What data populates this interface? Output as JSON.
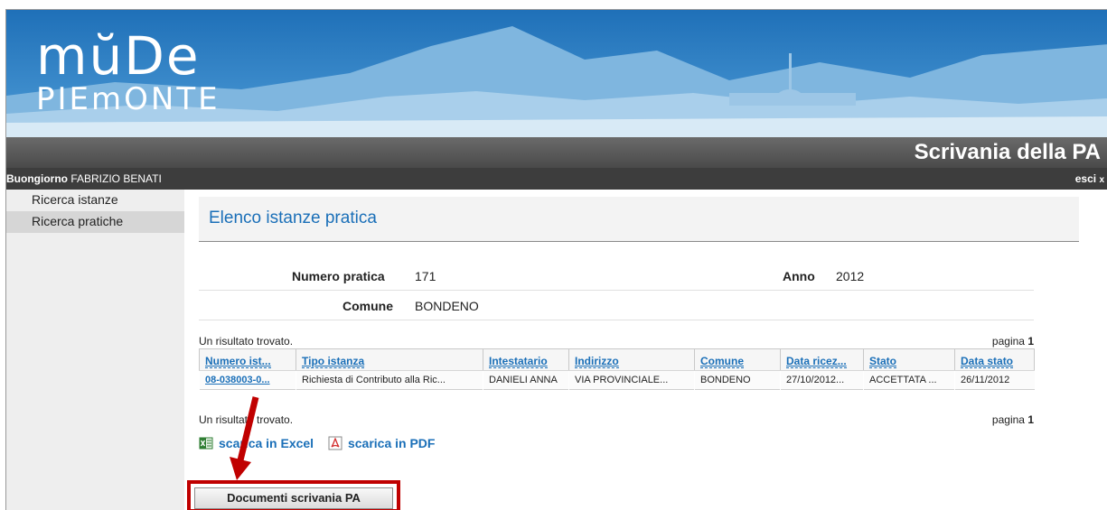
{
  "logo": {
    "line1": "mŭDe",
    "line2": "PIEmONTE"
  },
  "app_title": "Scrivania della PA",
  "greeting": {
    "prefix": "Buongiorno",
    "user": "FABRIZIO BENATI"
  },
  "logout": {
    "label": "esci",
    "icon": "x"
  },
  "sidebar": {
    "items": [
      {
        "label": "Ricerca istanze",
        "active": false
      },
      {
        "label": "Ricerca pratiche",
        "active": true
      }
    ]
  },
  "section_title": "Elenco istanze pratica",
  "info": {
    "numero_label": "Numero pratica",
    "numero_value": "171",
    "anno_label": "Anno",
    "anno_value": "2012",
    "comune_label": "Comune",
    "comune_value": "BONDENO"
  },
  "results": {
    "found_text": "Un risultato trovato.",
    "page_label": "pagina",
    "page_number": "1"
  },
  "table": {
    "headers": [
      "Numero ist...",
      "Tipo istanza",
      "Intestatario",
      "Indirizzo",
      "Comune",
      "Data ricez...",
      "Stato",
      "Data stato"
    ],
    "rows": [
      [
        "08-038003-0...",
        "Richiesta di Contributo alla Ric...",
        "DANIELI ANNA",
        "VIA PROVINCIALE...",
        "BONDENO",
        "27/10/2012...",
        "ACCETTATA ...",
        "26/11/2012"
      ]
    ]
  },
  "downloads": {
    "excel": "scarica in Excel",
    "pdf": "scarica in PDF",
    "excel_icon": "excel-icon",
    "pdf_icon": "pdf-icon"
  },
  "button": {
    "label": "Documenti scrivania PA"
  },
  "colors": {
    "link": "#1a6fb8",
    "highlight": "#c00000",
    "banner": "#2f7fc4"
  }
}
